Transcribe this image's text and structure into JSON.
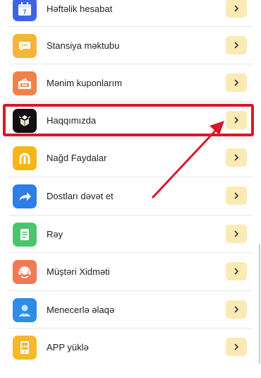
{
  "menu": {
    "items": [
      {
        "label": "Həftəlik hesabat",
        "icon": "calendar-icon",
        "color": "#3f63e6",
        "icon_text": "7"
      },
      {
        "label": "Stansiya məktubu",
        "icon": "chat-bubble-icon",
        "color": "#f7b535"
      },
      {
        "label": "Mənim kuponlarım",
        "icon": "coupon-icon",
        "color": "#f0824a"
      },
      {
        "label": "Haqqımızda",
        "icon": "app-logo-icon",
        "color": "#111111"
      },
      {
        "label": "Nağd Faydalar",
        "icon": "cash-icon",
        "color": "#f6b616"
      },
      {
        "label": "Dostları dəvət et",
        "icon": "share-icon",
        "color": "#2f7de8"
      },
      {
        "label": "Rəy",
        "icon": "feedback-icon",
        "color": "#4ac56e"
      },
      {
        "label": "Müştəri Xidməti",
        "icon": "headset-icon",
        "color": "#ef7a55"
      },
      {
        "label": "Menecerlə əlaqə",
        "icon": "manager-icon",
        "color": "#2e8ce6"
      },
      {
        "label": "APP yüklə",
        "icon": "app-download-icon",
        "color": "#f5b82b",
        "icon_text": "APP"
      }
    ],
    "arrow_symbol": ">"
  },
  "colors": {
    "arrow_button": "#fbeab4",
    "highlight": "#d8192b",
    "divider": "#e6e6e6"
  }
}
